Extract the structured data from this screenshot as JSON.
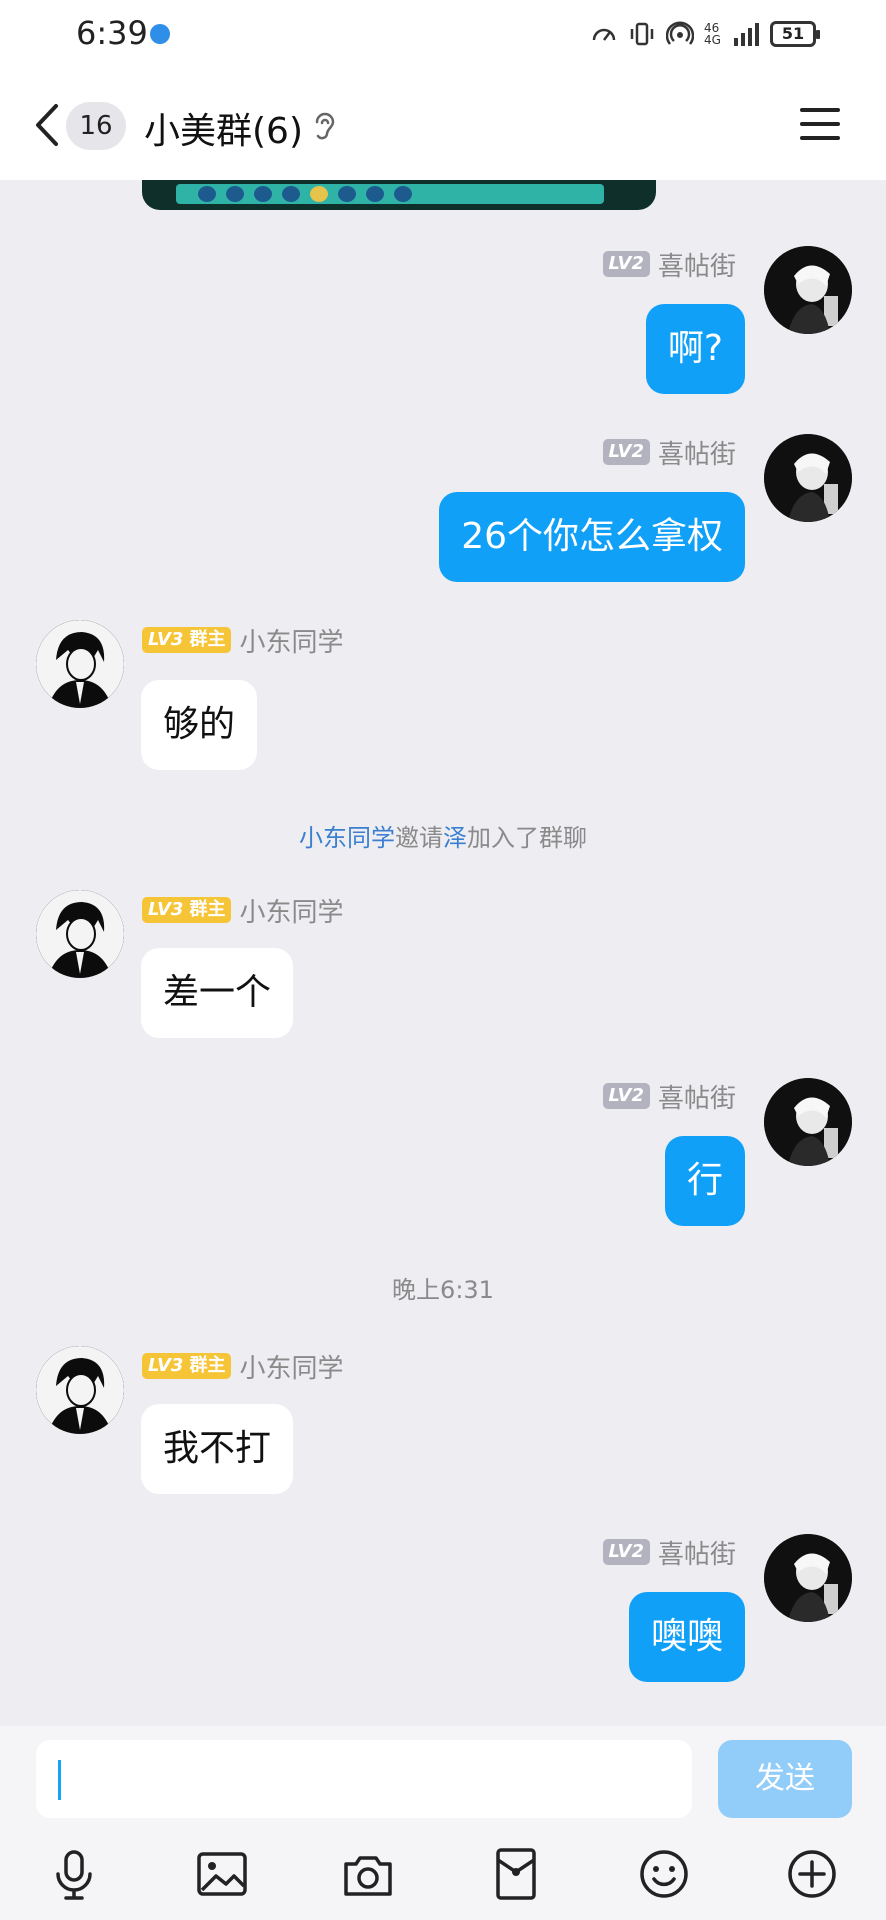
{
  "status_bar": {
    "time": "6:39",
    "network_top": "46",
    "network_bottom": "4G",
    "battery": "51"
  },
  "header": {
    "unread_count": "16",
    "title": "小美群(6)",
    "icons": [
      "back-arrow-icon",
      "ear-icon",
      "menu-icon"
    ]
  },
  "users": {
    "me": {
      "name": "喜帖街",
      "level": "LV2"
    },
    "owner": {
      "name": "小东同学",
      "level": "LV3",
      "role": "群主"
    }
  },
  "messages": [
    {
      "from": "me",
      "text": "啊?"
    },
    {
      "from": "me",
      "text": "26个你怎么拿权"
    },
    {
      "from": "owner",
      "text": "够的"
    },
    {
      "system": {
        "inviter": "小东同学",
        "action_1": "邀请",
        "invitee": "泽",
        "action_2": "加入了群聊"
      }
    },
    {
      "from": "owner",
      "text": "差一个"
    },
    {
      "from": "me",
      "text": "行"
    },
    {
      "time": "晚上6:31"
    },
    {
      "from": "owner",
      "text": "我不打"
    },
    {
      "from": "me",
      "text": "噢噢"
    }
  ],
  "input": {
    "value": "",
    "send_label": "发送"
  },
  "toolbar": {
    "icons": [
      "microphone-icon",
      "image-icon",
      "camera-icon",
      "red-packet-icon",
      "emoji-icon",
      "plus-icon"
    ]
  },
  "colors": {
    "outgoing_bubble": "#11a0f8",
    "incoming_bubble": "#ffffff",
    "background": "#ededf2",
    "owner_badge": "#f6c437",
    "level_badge": "#b3b3bf",
    "system_highlight": "#3b7fd0"
  }
}
